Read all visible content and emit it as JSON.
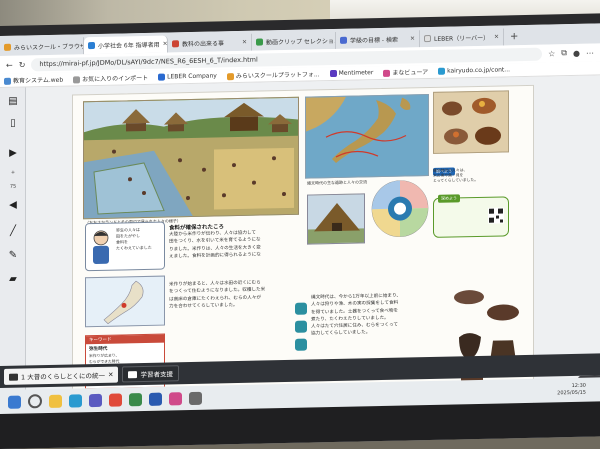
{
  "browser": {
    "tabs": [
      {
        "label": "みらいスクール・ブラウザ"
      },
      {
        "label": "小学社会 6年 指導者用"
      },
      {
        "label": "教科の出来る事"
      },
      {
        "label": "動画クリップ セレクション"
      },
      {
        "label": "学級の目標 - 検索"
      },
      {
        "label": "LEBER（リーバー）"
      }
    ],
    "tab_add": "+",
    "url": "https://mirai-pf.jp/JDMo/DL/sAYI/9dc7/NES_R6_6ESH_6_T/index.html",
    "bookmarks": [
      {
        "label": "教育システム.web"
      },
      {
        "label": "お気に入りのインポート"
      },
      {
        "label": "LEBER Company"
      },
      {
        "label": "みらいスクールプラットフォ..."
      },
      {
        "label": "Mentimeter"
      },
      {
        "label": "まなビューア"
      },
      {
        "label": "kairyudo.co.jp/cont..."
      }
    ]
  },
  "left_tools": {
    "expand_label": "+",
    "page_label": "75"
  },
  "textbook": {
    "left": {
      "heading": "食料が確保されたころ",
      "caption": "（おおさかランドとその周辺で見られた人々の様子）",
      "speech_text": [
        "弥生の人々は",
        "田をたがやし",
        "食料を",
        "たくわえていました"
      ],
      "body": [
        "大陸から米作りが伝わり、人々は協力して",
        "田をつくり、水を引いて米を育てるようにな",
        "りました。米作りは、人々の生活を大きく変",
        "えました。食料を計画的に得られるようにな"
      ],
      "body2": [
        "米作りが始まると、人々は水田の近くにむら",
        "をつくって住むようになりました。収穫した米",
        "は高床の倉庫にたくわえられ、むらの人々が",
        "力を合わせてくらしていました。"
      ],
      "sidebox_head": "キーワード",
      "sidebox_title": "弥生時代",
      "sidebox_text": [
        "米作りが広まり、",
        "むらができた時代",
        "を弥生時代といいます。"
      ],
      "page_number": "74",
      "bottom_note": "日本の歴史"
    },
    "right": {
      "tag_1": "調べよう",
      "tag_2": "深めよう",
      "map_caption": "縄文時代の主な遺跡と人々の交流",
      "note_text": [
        "縄文時代の人々は、",
        "木の実や魚・貝を",
        "とってくらしていました。"
      ],
      "body": [
        "縄文時代は、今から1万年以上前に始まり、",
        "人々は狩りや漁、木の実の採集をして食料",
        "を得ていました。土器をつくって食べ物を",
        "煮たり、たくわえたりしていました。",
        "人々はたて穴住居に住み、むらをつくって",
        "協力してくらしていました。"
      ],
      "page_number": "75"
    }
  },
  "pagebar": {
    "item_1": "1 大昔のくらしとくにの統一",
    "item_2": "学習者支援"
  },
  "zoom": "ナビ",
  "taskbar": {
    "time": "12:30",
    "date": "2025/05/15"
  }
}
